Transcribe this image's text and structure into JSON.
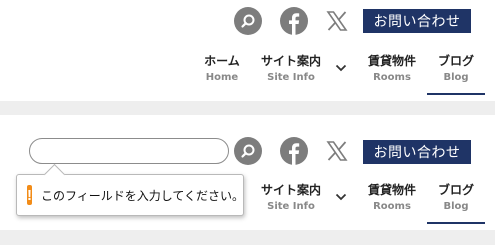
{
  "header": {
    "contact_label": "お問い合わせ",
    "nav": [
      {
        "jp": "ホーム",
        "en": "Home"
      },
      {
        "jp": "サイト案内",
        "en": "Site Info"
      },
      {
        "jp": "賃貸物件",
        "en": "Rooms"
      },
      {
        "jp": "ブログ",
        "en": "Blog"
      }
    ]
  },
  "tooltip": {
    "message": "このフィールドを入力してください。",
    "icon": "!"
  },
  "colors": {
    "brand": "#1f3466",
    "icon_gray": "#7d7d7d",
    "warning": "#f28c18"
  }
}
